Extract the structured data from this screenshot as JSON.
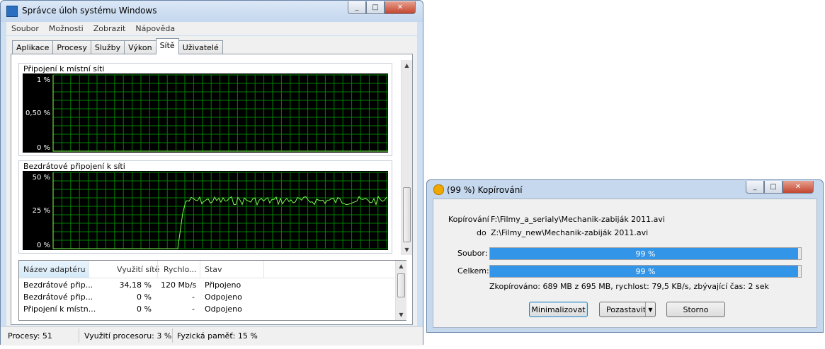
{
  "task_manager": {
    "title": "Správce úloh systému Windows",
    "menu": [
      "Soubor",
      "Možnosti",
      "Zobrazit",
      "Nápověda"
    ],
    "tabs": [
      "Aplikace",
      "Procesy",
      "Služby",
      "Výkon",
      "Sítě",
      "Uživatelé"
    ],
    "active_tab": "Sítě",
    "graph_lan": {
      "title": "Připojení k místní síti",
      "y_labels": [
        "1 %",
        "0,50 %",
        "0 %"
      ]
    },
    "graph_wifi": {
      "title": "Bezdrátové připojení k síti",
      "y_labels": [
        "50 %",
        "25 %",
        "0 %"
      ]
    },
    "list": {
      "headers": [
        "Název adaptéru",
        "Využití sítě",
        "Rychlo...",
        "Stav"
      ],
      "rows": [
        {
          "name": "Bezdrátové přip...",
          "usage": "34,18 %",
          "speed": "120 Mb/s",
          "state": "Připojeno"
        },
        {
          "name": "Bezdrátové přip...",
          "usage": "0 %",
          "speed": "-",
          "state": "Odpojeno"
        },
        {
          "name": "Připojení k místn...",
          "usage": "0 %",
          "speed": "-",
          "state": "Odpojeno"
        }
      ]
    },
    "status": {
      "processes": "Procesy: 51",
      "cpu": "Využití procesoru: 3 %",
      "memory": "Fyzická paměť: 15 %"
    },
    "window_buttons": [
      "_",
      "□",
      "✕"
    ]
  },
  "copy_dialog": {
    "title": "(99 %) Kopírování",
    "from_label": "Kopírování",
    "from_path": "F:\\Filmy_a_serialy\\Mechanik-zabiják 2011.avi",
    "to_label": "do",
    "to_path": "Z:\\Filmy_new\\Mechanik-zabiják 2011.avi",
    "file_label": "Soubor:",
    "file_progress": 99,
    "file_progress_text": "99 %",
    "total_label": "Celkem:",
    "total_progress": 99,
    "total_progress_text": "99 %",
    "summary": "Zkopírováno: 689 MB z 695 MB, rychlost: 79,5 KB/s, zbývající čas: 2 sek",
    "buttons": {
      "minimize": "Minimalizovat",
      "pause": "Pozastavit",
      "cancel": "Storno"
    }
  },
  "colors": {
    "grid": "#008000",
    "trace": "#7cff50",
    "progress": "#3395e8"
  }
}
